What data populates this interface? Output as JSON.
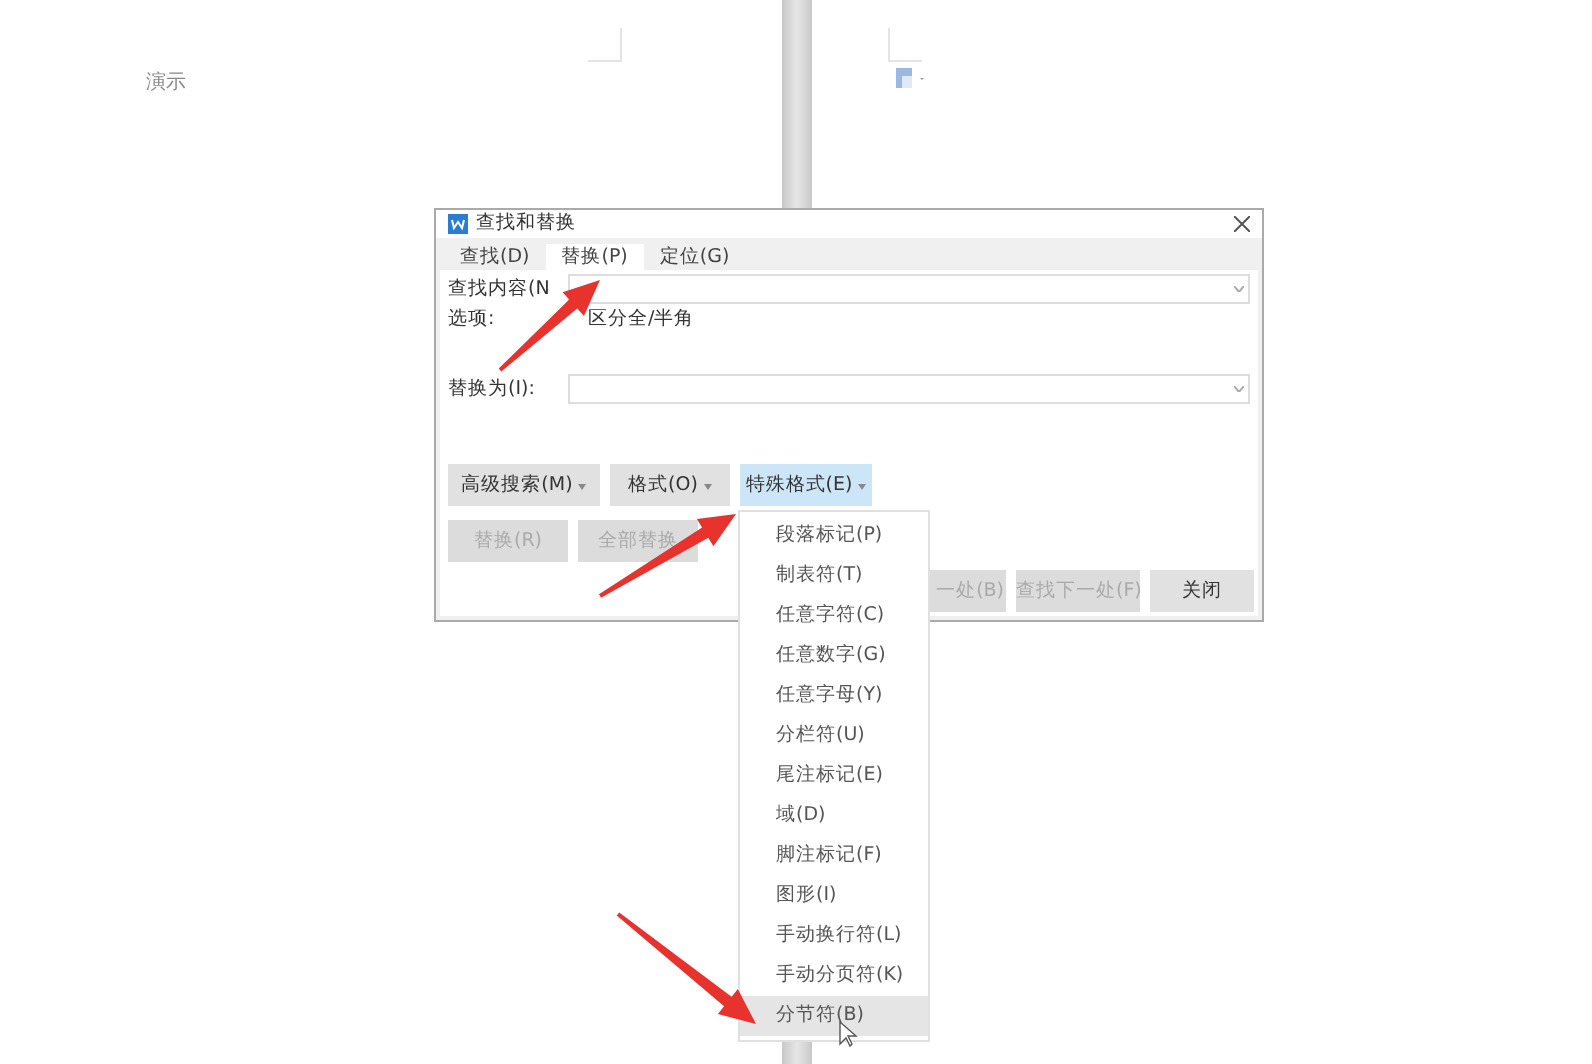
{
  "document": {
    "left_page_text": "演示"
  },
  "dialog": {
    "title": "查找和替换",
    "tabs": [
      {
        "label": "查找(D)",
        "selected": false
      },
      {
        "label": "替换(P)",
        "selected": true
      },
      {
        "label": "定位(G)",
        "selected": false
      }
    ],
    "find_label": "查找内容(N",
    "options_label": "选项:",
    "options_value": "区分全/半角",
    "replace_label": "替换为(I):",
    "format_buttons": [
      {
        "label": "高级搜索(M)",
        "selected": false
      },
      {
        "label": "格式(O)",
        "selected": false
      },
      {
        "label": "特殊格式(E)",
        "selected": true
      }
    ],
    "action_buttons": [
      {
        "label": "替换(R)",
        "disabled": true
      },
      {
        "label": "全部替换",
        "disabled": true
      }
    ],
    "bottom_buttons": [
      {
        "label": "一处(B)",
        "disabled": true
      },
      {
        "label": "查找下一处(F)",
        "disabled": true
      },
      {
        "label": "关闭",
        "disabled": false
      }
    ]
  },
  "special_menu": {
    "items": [
      {
        "label": "段落标记(P)",
        "selected": false
      },
      {
        "label": "制表符(T)",
        "selected": false
      },
      {
        "label": "任意字符(C)",
        "selected": false
      },
      {
        "label": "任意数字(G)",
        "selected": false
      },
      {
        "label": "任意字母(Y)",
        "selected": false
      },
      {
        "label": "分栏符(U)",
        "selected": false
      },
      {
        "label": "尾注标记(E)",
        "selected": false
      },
      {
        "label": "域(D)",
        "selected": false
      },
      {
        "label": "脚注标记(F)",
        "selected": false
      },
      {
        "label": "图形(I)",
        "selected": false
      },
      {
        "label": "手动换行符(L)",
        "selected": false
      },
      {
        "label": "手动分页符(K)",
        "selected": false
      },
      {
        "label": "分节符(B)",
        "selected": true
      }
    ]
  }
}
